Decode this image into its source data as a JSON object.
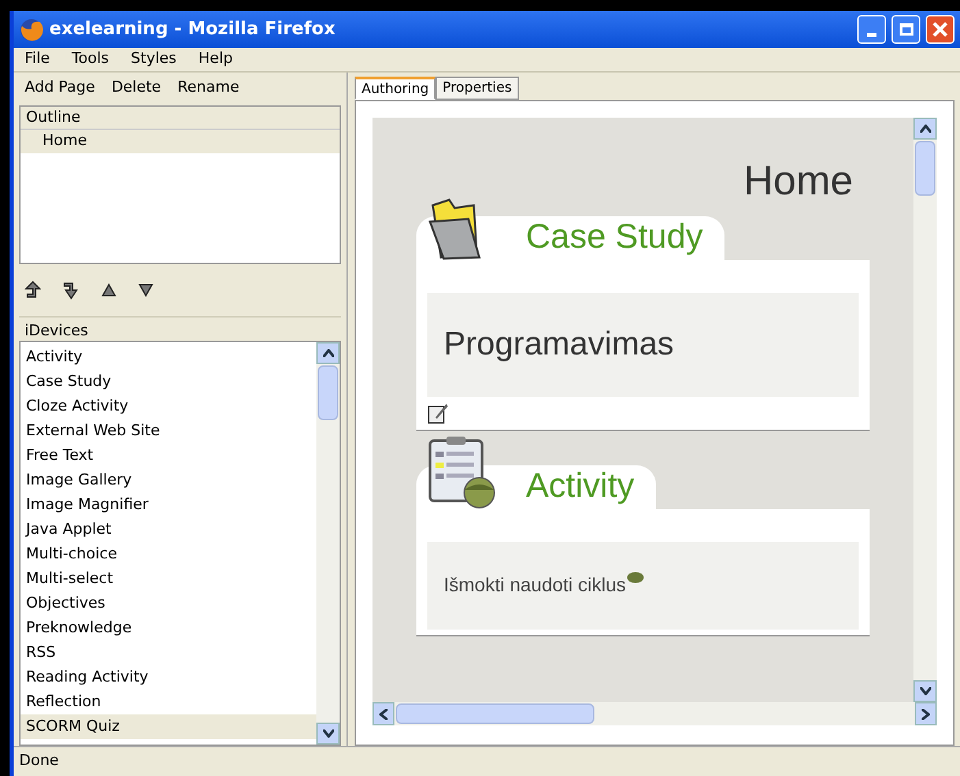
{
  "window": {
    "title": "exelearning - Mozilla Firefox"
  },
  "menu": [
    "File",
    "Tools",
    "Styles",
    "Help"
  ],
  "toolbar": [
    "Add Page",
    "Delete",
    "Rename"
  ],
  "outline": {
    "header": "Outline",
    "items": [
      {
        "label": "Home",
        "selected": true
      }
    ]
  },
  "idevices": {
    "title": "iDevices",
    "items": [
      {
        "label": "Activity",
        "selected": false
      },
      {
        "label": "Case Study",
        "selected": false
      },
      {
        "label": "Cloze Activity",
        "selected": false
      },
      {
        "label": "External Web Site",
        "selected": false
      },
      {
        "label": "Free Text",
        "selected": false
      },
      {
        "label": "Image Gallery",
        "selected": false
      },
      {
        "label": "Image Magnifier",
        "selected": false
      },
      {
        "label": "Java Applet",
        "selected": false
      },
      {
        "label": "Multi-choice",
        "selected": false
      },
      {
        "label": "Multi-select",
        "selected": false
      },
      {
        "label": "Objectives",
        "selected": false
      },
      {
        "label": "Preknowledge",
        "selected": false
      },
      {
        "label": "RSS",
        "selected": false
      },
      {
        "label": "Reading Activity",
        "selected": false
      },
      {
        "label": "Reflection",
        "selected": false
      },
      {
        "label": "SCORM Quiz",
        "selected": true
      }
    ]
  },
  "tabs": [
    {
      "label": "Authoring",
      "selected": true
    },
    {
      "label": "Properties",
      "selected": false
    }
  ],
  "page": {
    "title": "Home",
    "blocks": [
      {
        "kind": "case_study",
        "title": "Case Study",
        "content": "Programavimas"
      },
      {
        "kind": "activity",
        "title": "Activity",
        "content": "Išmokti naudoti ciklus"
      }
    ]
  },
  "status_bar": "Done"
}
